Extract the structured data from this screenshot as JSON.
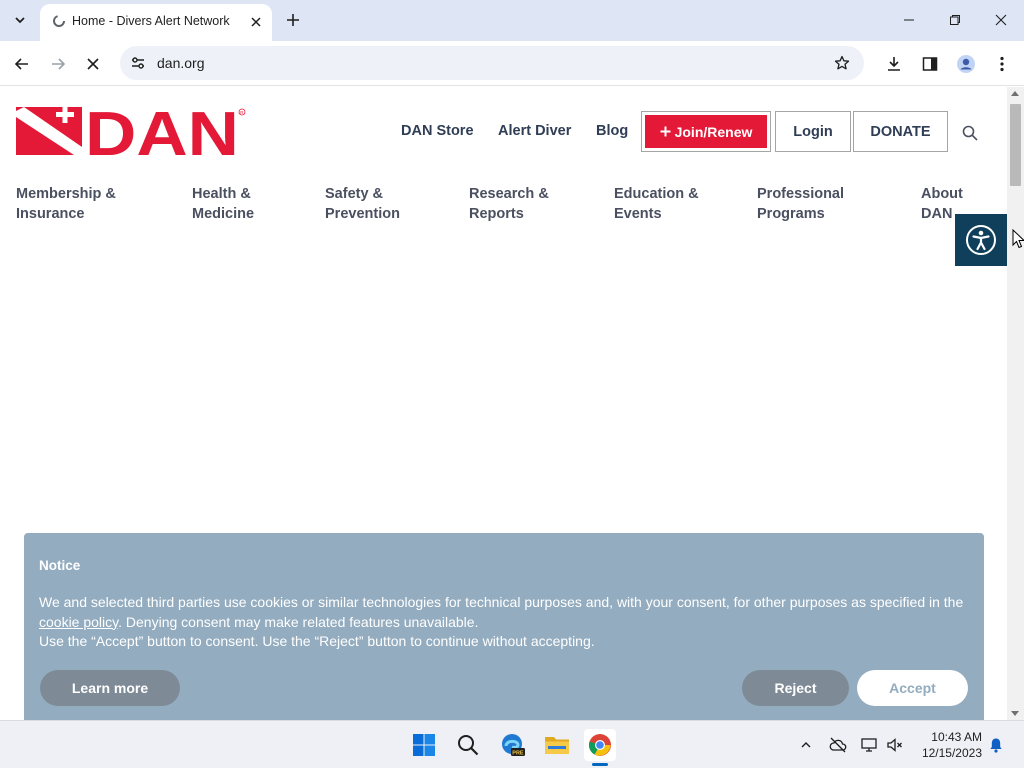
{
  "browser": {
    "tab_title": "Home - Divers Alert Network",
    "url": "dan.org"
  },
  "site": {
    "logo_text": "DAN",
    "top_nav": [
      "DAN Store",
      "Alert Diver",
      "Blog"
    ],
    "join_label": "Join/Renew",
    "login_label": "Login",
    "donate_label": "DONATE",
    "main_nav": [
      {
        "line1": "Membership &",
        "line2": "Insurance"
      },
      {
        "line1": "Health &",
        "line2": "Medicine"
      },
      {
        "line1": "Safety &",
        "line2": "Prevention"
      },
      {
        "line1": "Research &",
        "line2": "Reports"
      },
      {
        "line1": "Education &",
        "line2": "Events"
      },
      {
        "line1": "Professional",
        "line2": "Programs"
      },
      {
        "line1": "About",
        "line2": "DAN"
      }
    ]
  },
  "cookie": {
    "title": "Notice",
    "text_part1": "We and selected third parties use cookies or similar technologies for technical purposes and, with your consent, for other purposes as specified in the ",
    "link_text": "cookie policy",
    "text_part2": ". Denying consent may make related features unavailable.",
    "text_line2": "Use the “Accept” button to consent. Use the “Reject” button to continue without accepting.",
    "learn_more": "Learn more",
    "reject": "Reject",
    "accept": "Accept"
  },
  "taskbar": {
    "time": "10:43 AM",
    "date": "12/15/2023",
    "apps": [
      "windows-start-icon",
      "search-icon",
      "edge-beta-icon",
      "file-explorer-icon",
      "chrome-icon"
    ]
  },
  "colors": {
    "brand_red": "#e31937",
    "nav_text": "#2f3d55",
    "cookie_bg": "#93acbf",
    "a11y_bg": "#0f3f5a"
  }
}
